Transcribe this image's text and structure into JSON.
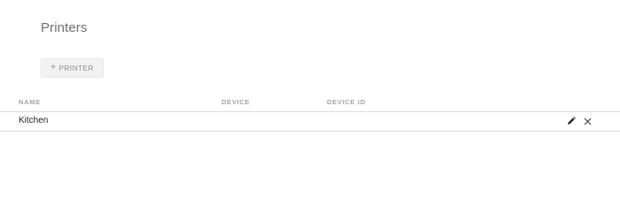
{
  "header": {
    "title": "Printers"
  },
  "toolbar": {
    "add_label": "PRINTER",
    "add_icon": "plus-icon"
  },
  "table": {
    "columns": [
      "NAME",
      "DEVICE",
      "DEVICE ID"
    ],
    "rows": [
      {
        "name": "Kitchen",
        "device": "",
        "device_id": "",
        "actions": [
          "edit-icon",
          "close-icon"
        ]
      }
    ]
  },
  "colors": {
    "title_text": "#6f6f6f",
    "header_text": "#a3a3a3",
    "row_text": "#222222",
    "divider": "#dcdcdc",
    "button_bg": "#f2f2f2"
  }
}
